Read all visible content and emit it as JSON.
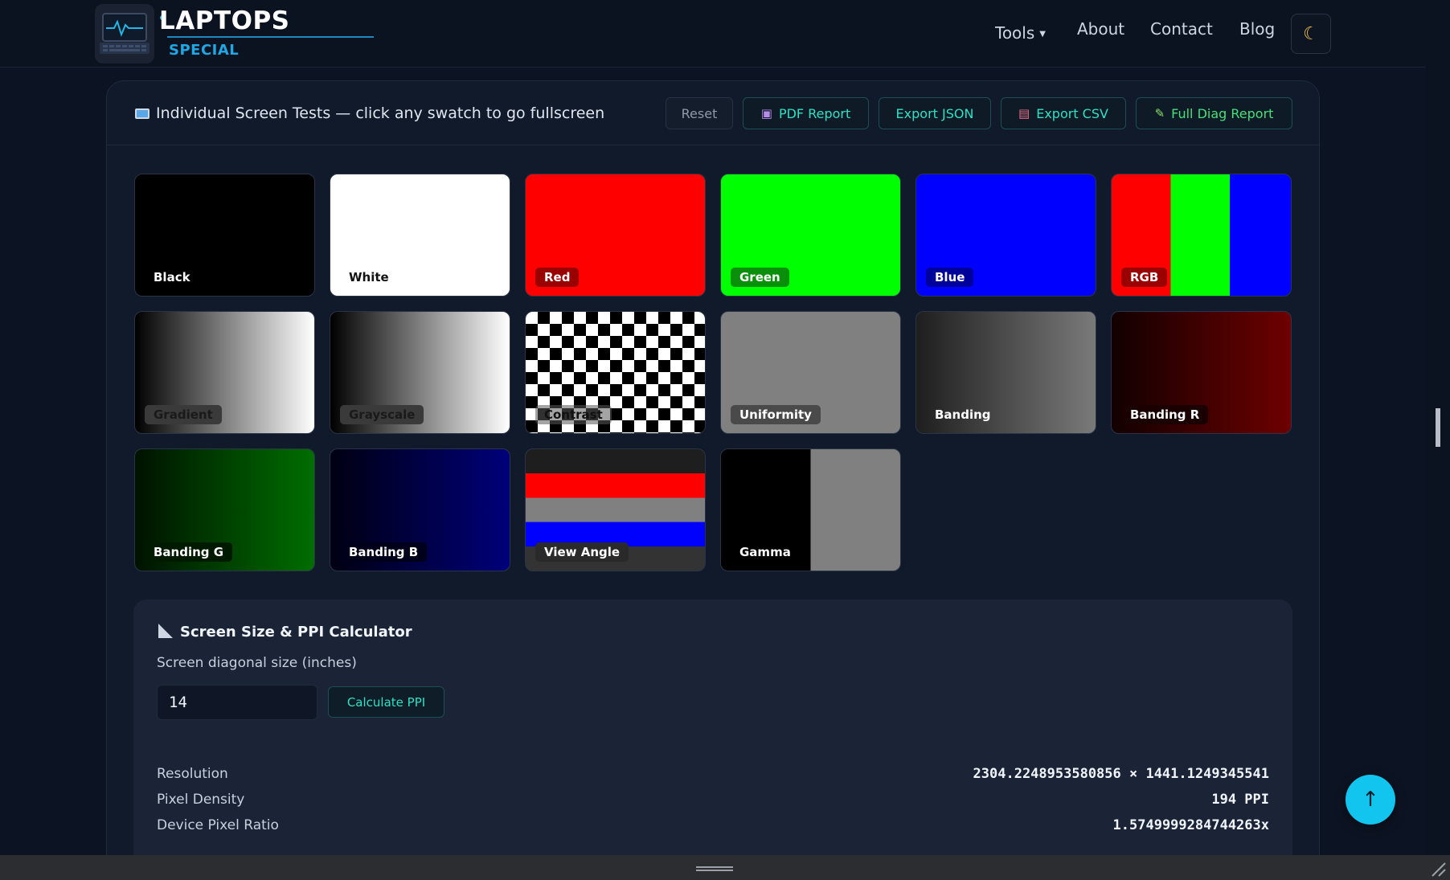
{
  "header": {
    "logo_title": "LAPTOPS",
    "logo_subtitle": "SPECIAL",
    "nav": {
      "tools": "Tools",
      "about": "About",
      "contact": "Contact",
      "blog": "Blog"
    },
    "theme_icon": "moon-icon"
  },
  "panel": {
    "title": "Individual Screen Tests — click any swatch to go fullscreen",
    "buttons": {
      "reset": "Reset",
      "pdf": "PDF Report",
      "json": "Export JSON",
      "csv": "Export CSV",
      "diag": "Full Diag Report"
    },
    "icons": {
      "title": "monitor-icon",
      "pdf": "floppy-disk-icon",
      "csv": "package-icon",
      "diag": "pencil-icon"
    }
  },
  "swatches": [
    {
      "label": "Black"
    },
    {
      "label": "White"
    },
    {
      "label": "Red"
    },
    {
      "label": "Green"
    },
    {
      "label": "Blue"
    },
    {
      "label": "RGB"
    },
    {
      "label": "Gradient"
    },
    {
      "label": "Grayscale"
    },
    {
      "label": "Contrast"
    },
    {
      "label": "Uniformity"
    },
    {
      "label": "Banding"
    },
    {
      "label": "Banding R"
    },
    {
      "label": "Banding G"
    },
    {
      "label": "Banding B"
    },
    {
      "label": "View Angle"
    },
    {
      "label": "Gamma"
    }
  ],
  "calculator": {
    "title": "Screen Size & PPI Calculator",
    "input_label": "Screen diagonal size (inches)",
    "input_value": "14",
    "button": "Calculate PPI",
    "stats": {
      "resolution_label": "Resolution",
      "resolution_value": "2304.2248953580856 × 1441.1249345541",
      "density_label": "Pixel Density",
      "density_value": "194 PPI",
      "dpr_label": "Device Pixel Ratio",
      "dpr_value": "1.5749999284744263x"
    }
  },
  "back_to_top": "↑",
  "colors": {
    "accent": "#2ee0c4",
    "brand": "#1ea8e6",
    "background": "#0c1322"
  }
}
